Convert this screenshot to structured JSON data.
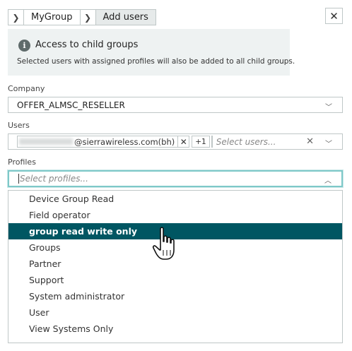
{
  "breadcrumb": {
    "items": [
      "MyGroup"
    ],
    "current": "Add users"
  },
  "info": {
    "title": "Access to child groups",
    "text": "Selected users with assigned profiles will also be added to all child groups."
  },
  "company": {
    "label": "Company",
    "value": "OFFER_ALMSC_RESELLER"
  },
  "users": {
    "label": "Users",
    "chip_suffix": "@sierrawireless.com(bh)",
    "more": "+1",
    "placeholder": "Select users..."
  },
  "profiles": {
    "label": "Profiles",
    "placeholder": "Select profiles...",
    "options": [
      "Device Group Read",
      "Field operator",
      "group read write only",
      "Groups",
      "Partner",
      "Support",
      "System administrator",
      "User",
      "View Systems Only"
    ],
    "highlighted": "group read write only"
  },
  "colors": {
    "highlight": "#005662",
    "focus_border": "#7ec8c8",
    "info_bg": "#eef2f2"
  }
}
